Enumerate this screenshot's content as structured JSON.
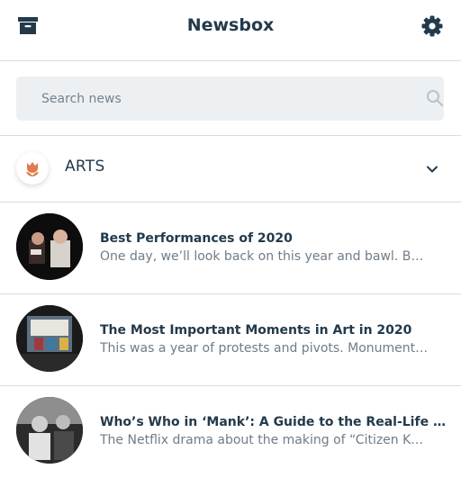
{
  "header": {
    "title": "Newsbox",
    "left_icon": "archive-icon",
    "right_icon": "gear-icon"
  },
  "search": {
    "placeholder": "Search news",
    "value": "",
    "icon": "search-icon"
  },
  "category": {
    "label": "ARTS",
    "icon": "tulip-icon",
    "accent": "#e07a4f",
    "chevron": "chevron-down-icon"
  },
  "articles": [
    {
      "title": "Best Performances of 2020",
      "snippet": "One day, we’ll look back on this year and bawl. But what we’ll remember"
    },
    {
      "title": "The Most Important Moments in Art in 2020",
      "snippet": "This was a year of protests and pivots. Monuments came down"
    },
    {
      "title": "Who’s Who in ‘Mank’: A Guide to the Real-Life Players",
      "snippet": "The Netflix drama about the making of “Citizen Kane” is filled"
    }
  ],
  "colors": {
    "text": "#233a4b",
    "muted": "#6f7c88",
    "divider": "#d9dcdf",
    "search_bg": "#edf0f2"
  }
}
